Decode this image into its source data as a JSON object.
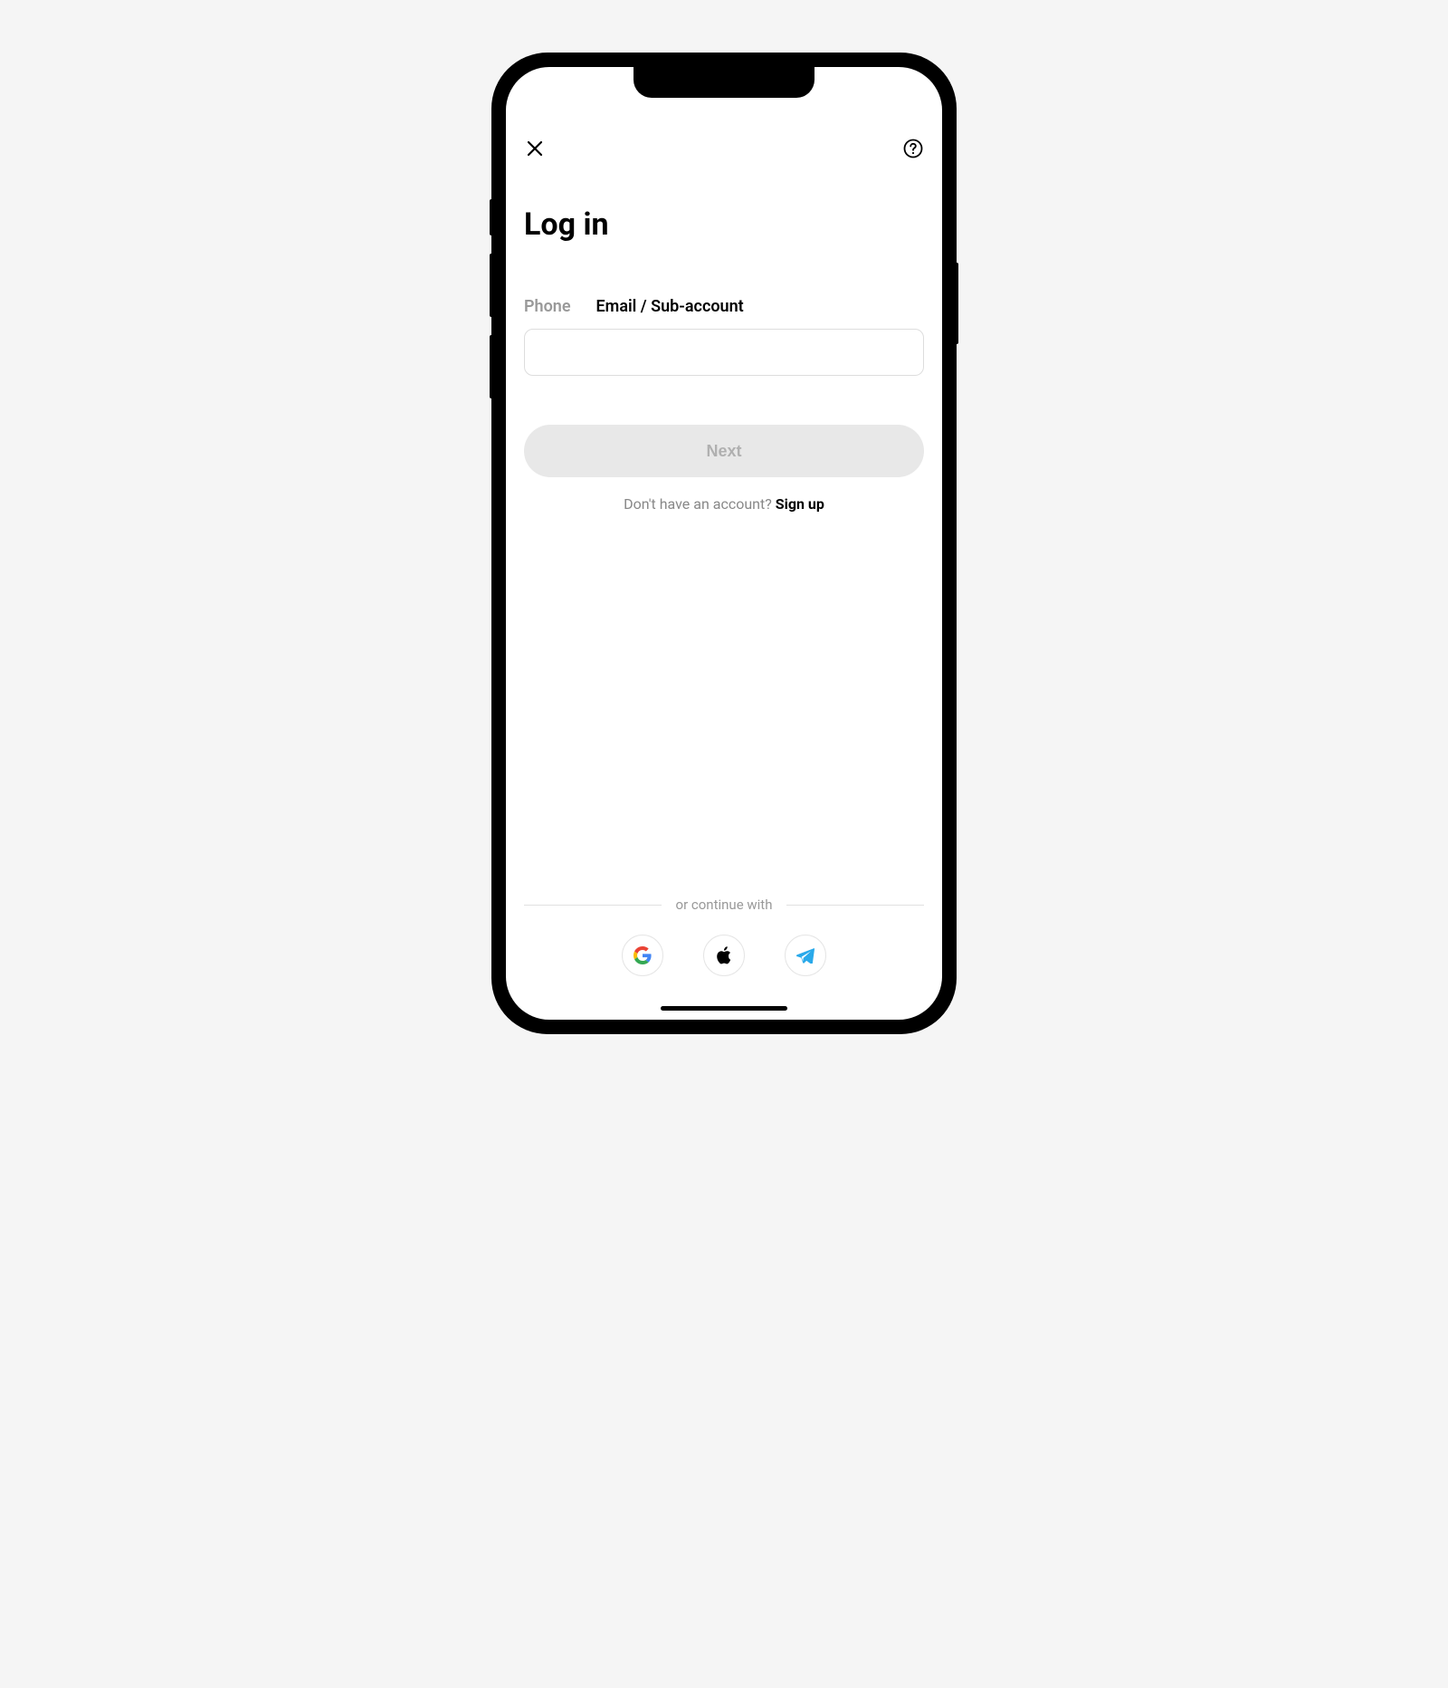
{
  "header": {
    "title": "Log in"
  },
  "tabs": {
    "phone": "Phone",
    "email": "Email / Sub-account",
    "active": "email"
  },
  "input": {
    "value": "",
    "placeholder": ""
  },
  "actions": {
    "next_label": "Next",
    "signup_prompt": "Don't have an account? ",
    "signup_link": "Sign up"
  },
  "social": {
    "divider_label": "or continue with",
    "providers": [
      "google",
      "apple",
      "telegram"
    ]
  },
  "icons": {
    "close": "close-icon",
    "help": "help-icon"
  }
}
